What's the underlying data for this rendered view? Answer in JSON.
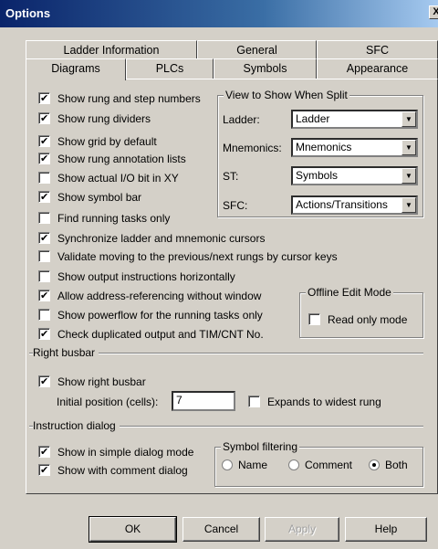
{
  "window": {
    "title": "Options",
    "close_glyph": "X"
  },
  "tabs_back": [
    {
      "label": "Ladder Information"
    },
    {
      "label": "General"
    },
    {
      "label": "SFC"
    }
  ],
  "tabs_front": [
    {
      "label": "Diagrams",
      "active": true
    },
    {
      "label": "PLCs"
    },
    {
      "label": "Symbols"
    },
    {
      "label": "Appearance"
    }
  ],
  "options": [
    {
      "label": "Show rung and step numbers",
      "checked": true
    },
    {
      "label": "Show rung dividers",
      "checked": true
    },
    {
      "label": "Show grid by default",
      "checked": true
    },
    {
      "label": "Show rung annotation lists",
      "checked": true
    },
    {
      "label": "Show actual I/O bit in XY",
      "checked": false
    },
    {
      "label": "Show symbol bar",
      "checked": true
    },
    {
      "label": "Find running tasks only",
      "checked": false
    },
    {
      "label": "Synchronize ladder and mnemonic cursors",
      "checked": true
    },
    {
      "label": "Validate moving to the previous/next rungs by cursor keys",
      "checked": false
    },
    {
      "label": "Show output instructions horizontally",
      "checked": false
    },
    {
      "label": "Allow address-referencing without window",
      "checked": true
    },
    {
      "label": "Show powerflow for the running tasks only",
      "checked": false
    },
    {
      "label": "Check duplicated output and TIM/CNT No.",
      "checked": true
    }
  ],
  "split_view": {
    "title": "View to Show When Split",
    "rows": [
      {
        "label": "Ladder:",
        "value": "Ladder"
      },
      {
        "label": "Mnemonics:",
        "value": "Mnemonics"
      },
      {
        "label": "ST:",
        "value": "Symbols"
      },
      {
        "label": "SFC:",
        "value": "Actions/Transitions"
      }
    ]
  },
  "offline_edit": {
    "title": "Offline Edit Mode",
    "read_only_label": "Read only mode",
    "read_only_checked": false
  },
  "right_busbar": {
    "section_label": "Right busbar",
    "show_label": "Show right busbar",
    "show_checked": true,
    "position_label": "Initial position (cells):",
    "position_value": "7",
    "expand_label": "Expands to widest rung",
    "expand_checked": false
  },
  "instruction_dialog": {
    "section_label": "Instruction dialog",
    "simple_label": "Show in simple dialog mode",
    "simple_checked": true,
    "comment_label": "Show with comment dialog",
    "comment_checked": true
  },
  "symbol_filtering": {
    "title": "Symbol filtering",
    "options": [
      {
        "label": "Name",
        "checked": false
      },
      {
        "label": "Comment",
        "checked": false
      },
      {
        "label": "Both",
        "checked": true
      }
    ]
  },
  "buttons": {
    "ok": "OK",
    "cancel": "Cancel",
    "apply": "Apply",
    "help": "Help"
  }
}
